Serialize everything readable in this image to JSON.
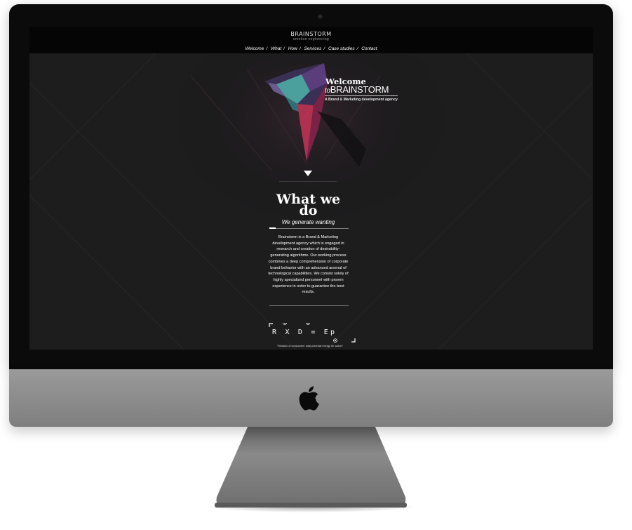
{
  "site": {
    "brand": "BRAINSTORM",
    "tagline": "emotion engineering",
    "nav": [
      "Welcome",
      "What",
      "How",
      "Services",
      "Case studies",
      "Contact"
    ]
  },
  "hero": {
    "welcome": "Welcome",
    "to": "to",
    "brand": "BRAINSTORM",
    "subtitle": "A Brand & Marketing development agency"
  },
  "what_we_do": {
    "title_line1": "What we",
    "title_line2": "do",
    "subtitle": "We generate wanting",
    "body": "Brainstorm is a Brand & Marketing development agency which is engaged in research and creation of desirability-generating algorithms. Our working process combines a deep comprehension of corporate brand behavior with an advanced arsenal of technological capabilities. We consist solely of highly specialized personnel with proven experience in order to guarantee the best results."
  },
  "formula": {
    "text": "R X D = Ep",
    "note": "\"Relation of consumers' total potential energy for action\""
  },
  "colors": {
    "screen_bg": "#1d1d1e",
    "topbar_bg": "#050505",
    "crystal_teal": "#4fb3a9",
    "crystal_purple": "#5a3d7a",
    "crystal_magenta": "#b0304f",
    "body_aluminum": "#8a8a8a"
  },
  "icons": {
    "camera": "camera-dot-icon",
    "logo": "apple-logo-icon",
    "arrow": "down-arrow-icon",
    "crystal": "crystal-logo-icon"
  }
}
